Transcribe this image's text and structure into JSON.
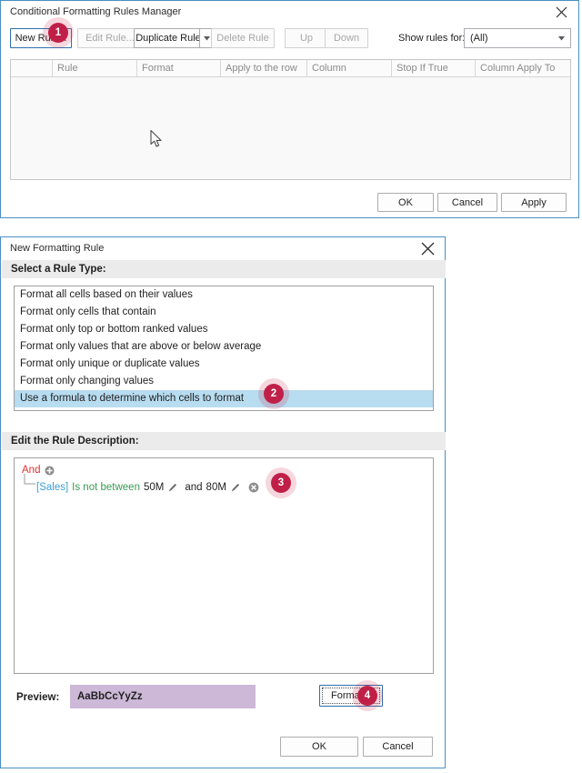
{
  "rules_manager": {
    "title": "Conditional Formatting Rules Manager",
    "close_icon": "close-icon",
    "toolbar": {
      "new_rule": "New Rule...",
      "edit_rule": "Edit Rule...",
      "duplicate_rule": "Duplicate Rule",
      "duplicate_dropdown_icon": "chevron-down-icon",
      "delete_rule": "Delete Rule",
      "up": "Up",
      "down": "Down",
      "show_rules_for_label": "Show rules for:",
      "show_rules_for_value": "(All)",
      "show_rules_for_options": [
        "(All)"
      ]
    },
    "grid": {
      "columns": [
        "",
        "Rule",
        "Format",
        "Apply to the row",
        "Column",
        "Stop If True",
        "Column Apply To"
      ],
      "rows": []
    },
    "footer": {
      "ok": "OK",
      "cancel": "Cancel",
      "apply": "Apply"
    }
  },
  "new_rule": {
    "title": "New Formatting Rule",
    "close_icon": "close-icon",
    "rule_type_heading": "Select a Rule Type:",
    "rule_types": [
      "Format all cells based on their values",
      "Format only cells that contain",
      "Format only top or bottom ranked values",
      "Format only values that are above or below average",
      "Format only unique or duplicate values",
      "Format only changing values",
      "Use a formula to determine which cells to format"
    ],
    "selected_rule_type_index": 6,
    "rule_description_heading": "Edit the Rule Description:",
    "condition": {
      "group_operator": "And",
      "add_icon": "add-circle-icon",
      "field": "[Sales]",
      "operator": "Is not between",
      "value_1": "50M",
      "value_1_edit_icon": "pencil-icon",
      "conjunction": "and",
      "value_2": "80M",
      "value_2_edit_icon": "pencil-icon",
      "remove_icon": "remove-circle-icon"
    },
    "preview": {
      "label": "Preview:",
      "sample_text": "AaBbCcYyZz",
      "swatch_color": "#cdb8d8",
      "format_button": "Format..."
    },
    "footer": {
      "ok": "OK",
      "cancel": "Cancel"
    }
  },
  "annotations": {
    "badges": [
      "1",
      "2",
      "3",
      "4"
    ],
    "badge_color": "#c02048"
  }
}
